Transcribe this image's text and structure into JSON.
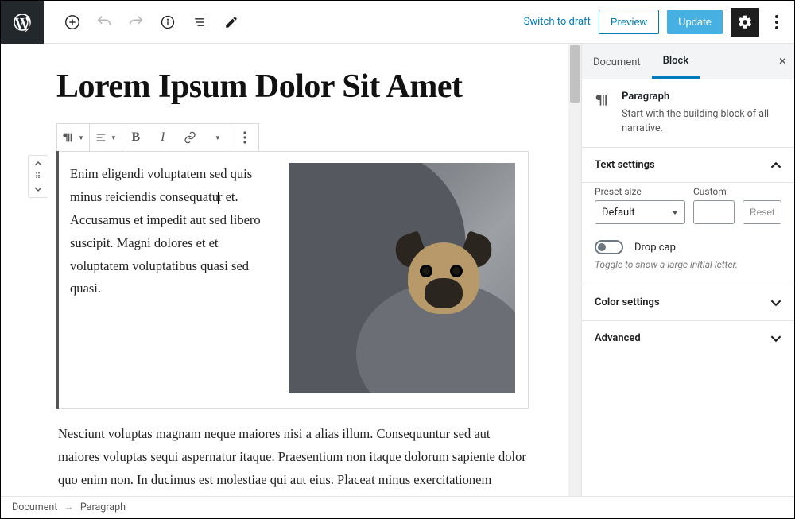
{
  "header": {
    "switch_to_draft": "Switch to draft",
    "preview": "Preview",
    "update": "Update"
  },
  "editor": {
    "title": "Lorem Ipsum Dolor Sit Amet",
    "para1a": "Enim eligendi voluptatem sed quis minus reiciendis consequatu",
    "para1b": "r et. Accusamus et impedit aut sed libero suscipit. Magni dolores et et voluptatem voluptatibus quasi sed quasi.",
    "para2": "Nesciunt voluptas magnam neque maiores nisi a alias illum. Consequuntur sed aut maiores voluptas sequi aspernatur itaque. Praesentium non itaque dolorum sapiente dolor quo enim non. In ducimus est molestiae qui aut eius. Placeat minus exercitationem perferendis voluptates alias."
  },
  "sidebar": {
    "tab_document": "Document",
    "tab_block": "Block",
    "block_name": "Paragraph",
    "block_desc": "Start with the building block of all narrative.",
    "panel_text": "Text settings",
    "preset_label": "Preset size",
    "preset_value": "Default",
    "custom_label": "Custom",
    "reset": "Reset",
    "dropcap": "Drop cap",
    "dropcap_hint": "Toggle to show a large initial letter.",
    "panel_color": "Color settings",
    "panel_advanced": "Advanced"
  },
  "footer": {
    "crumb1": "Document",
    "crumb2": "Paragraph"
  }
}
